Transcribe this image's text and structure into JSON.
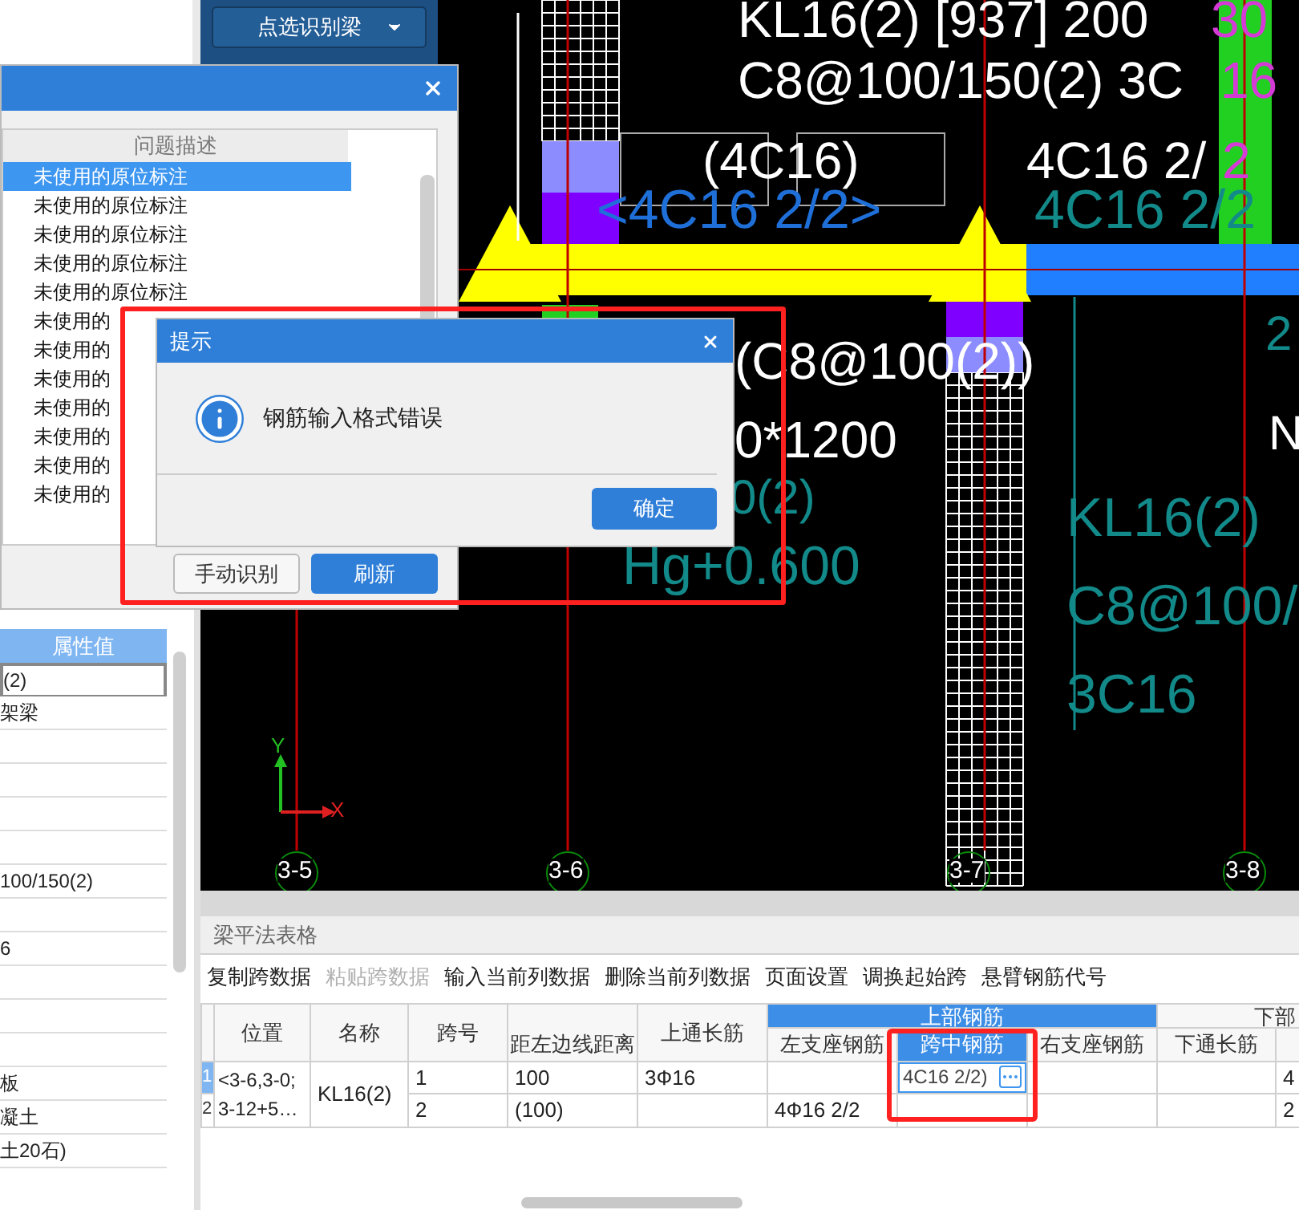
{
  "side_panel": {
    "button": "点选识别梁"
  },
  "problem_dialog": {
    "column_header": "问题描述",
    "rows": [
      {
        "text": "未使用的原位标注",
        "selected": true
      },
      {
        "text": "未使用的原位标注",
        "selected": false
      },
      {
        "text": "未使用的原位标注",
        "selected": false
      },
      {
        "text": "未使用的原位标注",
        "selected": false
      },
      {
        "text": "未使用的原位标注",
        "selected": false
      },
      {
        "text": "未使用的",
        "selected": false
      },
      {
        "text": "未使用的",
        "selected": false
      },
      {
        "text": "未使用的",
        "selected": false
      },
      {
        "text": "未使用的",
        "selected": false
      },
      {
        "text": "未使用的",
        "selected": false
      },
      {
        "text": "未使用的",
        "selected": false
      },
      {
        "text": "未使用的",
        "selected": false
      }
    ],
    "buttons": [
      {
        "label": "手动识别",
        "primary": false
      },
      {
        "label": "刷新",
        "primary": true
      }
    ]
  },
  "alert": {
    "title": "提示",
    "message": "钢筋输入格式错误",
    "button": "确定"
  },
  "properties": {
    "header": "属性值",
    "rows": [
      {
        "value": "(2)",
        "selected": true
      },
      {
        "value": "架梁",
        "selected": false
      },
      {
        "value": "",
        "selected": false
      },
      {
        "value": "",
        "selected": false
      },
      {
        "value": "",
        "selected": false
      },
      {
        "value": "",
        "selected": false
      },
      {
        "value": "100/150(2)",
        "selected": false
      },
      {
        "value": "",
        "selected": false
      },
      {
        "value": "6",
        "selected": false
      },
      {
        "value": "",
        "selected": false
      },
      {
        "value": "",
        "selected": false
      },
      {
        "value": "",
        "selected": false
      },
      {
        "value": "板",
        "selected": false
      },
      {
        "value": "凝土",
        "selected": false
      },
      {
        "value": "土20石)",
        "selected": false
      }
    ]
  },
  "canvas": {
    "labels": [
      {
        "text": "KL16(2) [937] 200",
        "kind": "white"
      },
      {
        "text": "30",
        "kind": "magenta"
      },
      {
        "text": "C8@100/150(2) 3C",
        "kind": "white"
      },
      {
        "text": "16",
        "kind": "magenta"
      },
      {
        "text": "(4C16)",
        "kind": "white"
      },
      {
        "text": "4C16 2/",
        "kind": "white"
      },
      {
        "text": "2",
        "kind": "magenta"
      },
      {
        "text": "<4C16 2/2>",
        "kind": "blue"
      },
      {
        "text": "4C16 2/2",
        "kind": "teal"
      },
      {
        "text": "(C8@100(2))",
        "kind": "white"
      },
      {
        "text": "0*1200",
        "kind": "white"
      },
      {
        "text": "0(2)",
        "kind": "teal"
      },
      {
        "text": "Hg+0.600",
        "kind": "teal"
      },
      {
        "text": "KL16(2)",
        "kind": "teal"
      },
      {
        "text": "C8@100/",
        "kind": "teal"
      },
      {
        "text": "3C16",
        "kind": "teal"
      },
      {
        "text": "2",
        "kind": "teal"
      },
      {
        "text": "N",
        "kind": "white"
      }
    ],
    "axis_labels": [
      "3-5",
      "3-6",
      "3-7",
      "3-8"
    ],
    "axis_y": "Y",
    "axis_x": "X"
  },
  "table_panel": {
    "title": "梁平法表格",
    "toolbar": [
      {
        "label": "复制跨数据",
        "disabled": false
      },
      {
        "label": "粘贴跨数据",
        "disabled": true
      },
      {
        "label": "输入当前列数据",
        "disabled": false
      },
      {
        "label": "删除当前列数据",
        "disabled": false
      },
      {
        "label": "页面设置",
        "disabled": false
      },
      {
        "label": "调换起始跨",
        "disabled": false
      },
      {
        "label": "悬臂钢筋代号",
        "disabled": false
      }
    ],
    "headers": {
      "position": "位置",
      "name": "名称",
      "span": "跨号",
      "distance": "距左边线距离",
      "top_through": "上通长筋",
      "top_group": "上部钢筋",
      "bottom_group": "下部",
      "top_columns": [
        {
          "label": "左支座钢筋",
          "selected": false
        },
        {
          "label": "跨中钢筋",
          "selected": true
        },
        {
          "label": "右支座钢筋",
          "selected": false
        }
      ],
      "bottom_through": "下通长筋"
    },
    "position": "<3-6,3-0;\n3-12+5…",
    "name": "KL16(2)",
    "rows": [
      {
        "num": "1",
        "selected": true,
        "span": "1",
        "distance": "100",
        "top_through": "3Ф16",
        "left": "",
        "middle": "4C16 2/2)",
        "right": "",
        "bottom_through": "",
        "column_11": "4"
      },
      {
        "num": "2",
        "selected": false,
        "span": "2",
        "distance": "(100)",
        "top_through": "",
        "left": "4Ф16 2/2",
        "middle": "",
        "right": "",
        "bottom_through": "",
        "column_11": "2"
      }
    ]
  }
}
